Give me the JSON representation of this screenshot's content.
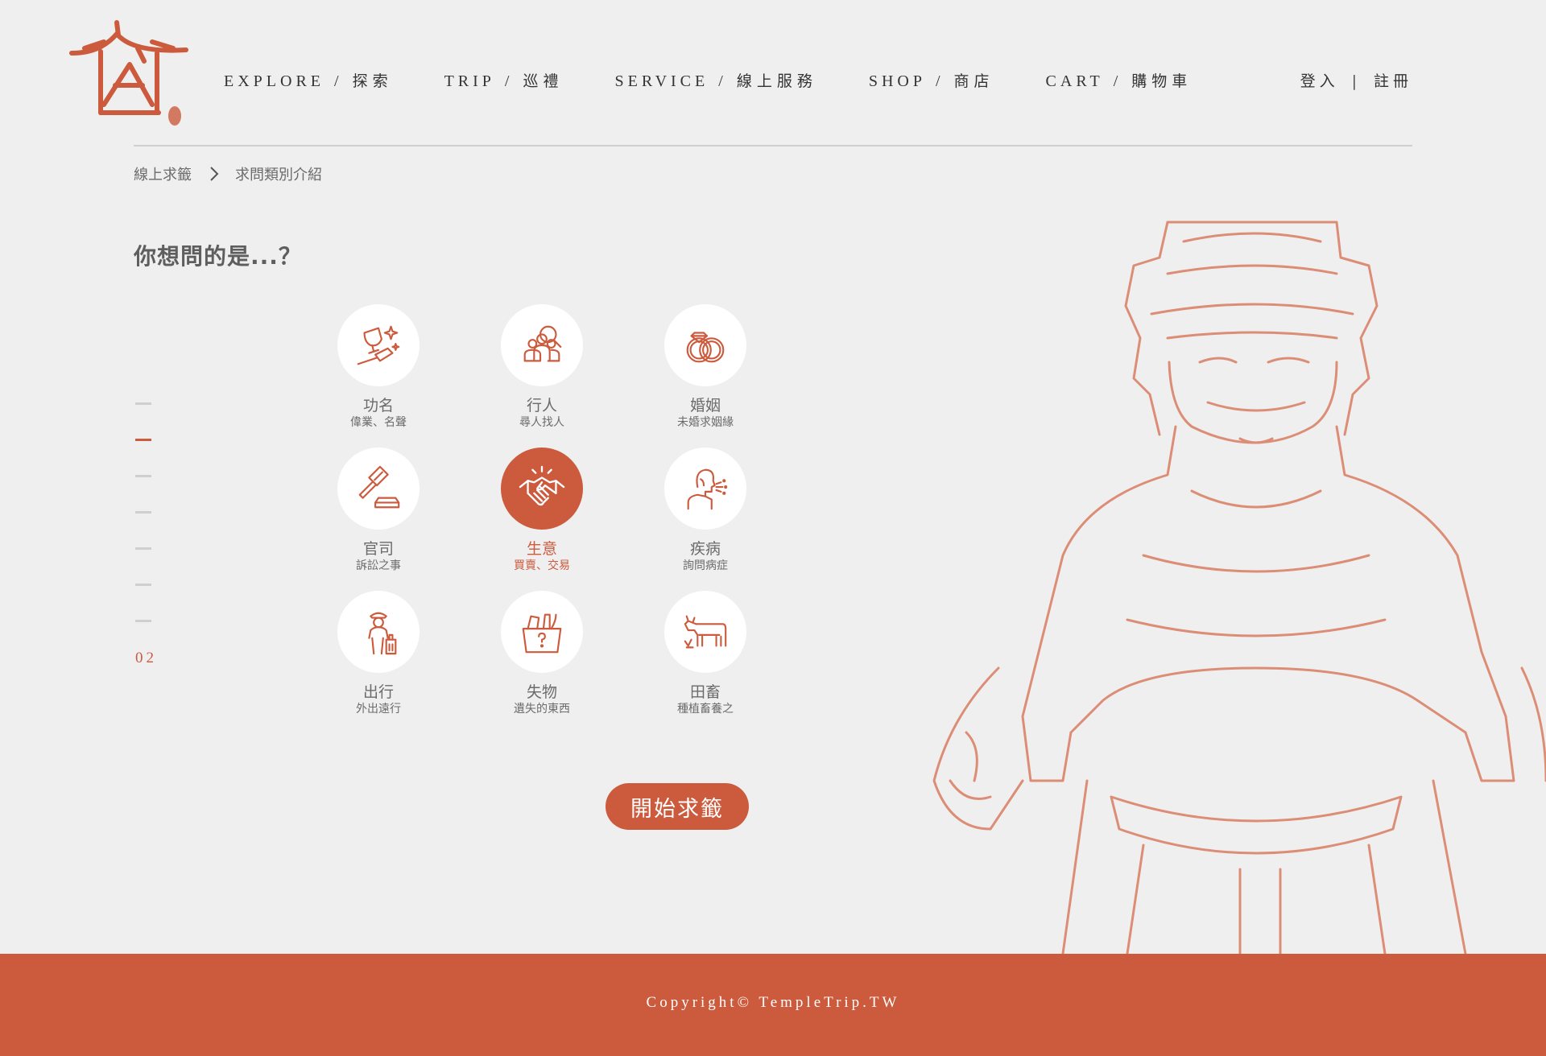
{
  "header": {
    "nav": [
      {
        "en": "EXPLORE",
        "zh": "探索"
      },
      {
        "en": "TRIP",
        "zh": "巡禮"
      },
      {
        "en": "SERVICE",
        "zh": "線上服務"
      },
      {
        "en": "SHOP",
        "zh": "商店"
      },
      {
        "en": "CART",
        "zh": "購物車"
      }
    ],
    "separator": "/",
    "auth": {
      "login": "登入",
      "divider": "|",
      "register": "註冊"
    }
  },
  "breadcrumb": [
    "線上求籤",
    "求問類別介紹"
  ],
  "question": "你想問的是...？",
  "pager": {
    "total_marks": 7,
    "active_index": 1,
    "current": "02"
  },
  "categories": [
    {
      "title": "功名",
      "subtitle": "偉業、名聲",
      "icon": "trophy-icon",
      "selected": false
    },
    {
      "title": "行人",
      "subtitle": "尋人找人",
      "icon": "people-search-icon",
      "selected": false
    },
    {
      "title": "婚姻",
      "subtitle": "未婚求姻緣",
      "icon": "rings-icon",
      "selected": false
    },
    {
      "title": "官司",
      "subtitle": "訴訟之事",
      "icon": "gavel-icon",
      "selected": false
    },
    {
      "title": "生意",
      "subtitle": "買賣、交易",
      "icon": "handshake-icon",
      "selected": true
    },
    {
      "title": "疾病",
      "subtitle": "詢問病症",
      "icon": "sick-person-icon",
      "selected": false
    },
    {
      "title": "出行",
      "subtitle": "外出遠行",
      "icon": "traveler-icon",
      "selected": false
    },
    {
      "title": "失物",
      "subtitle": "遺失的東西",
      "icon": "lost-box-icon",
      "selected": false
    },
    {
      "title": "田畜",
      "subtitle": "種植畜養之",
      "icon": "cow-icon",
      "selected": false
    }
  ],
  "start_button": "開始求籤",
  "footer": {
    "copyright": "Copyright© TempleTrip.TW"
  },
  "colors": {
    "accent": "#cc5a3d",
    "background": "#efefef",
    "text": "#6b6b6b"
  }
}
